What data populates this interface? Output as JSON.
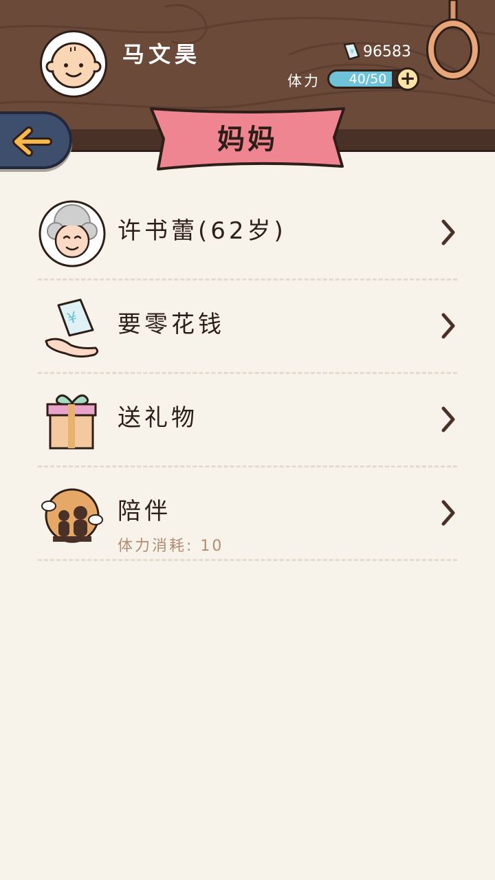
{
  "header": {
    "player_name": "马文昊",
    "money": "96583",
    "stamina_label": "体力",
    "stamina_text": "40/50",
    "stamina_fraction": 0.8,
    "stamina_plus": "+"
  },
  "banner": {
    "title": "妈妈"
  },
  "list": {
    "items": [
      {
        "title": "许书蕾(62岁)",
        "subtitle": "",
        "icon": "grandmother-avatar-icon"
      },
      {
        "title": "要零花钱",
        "subtitle": "",
        "icon": "money-hand-icon"
      },
      {
        "title": "送礼物",
        "subtitle": "",
        "icon": "gift-box-icon"
      },
      {
        "title": "陪伴",
        "subtitle": "体力消耗: 10",
        "icon": "companionship-icon"
      }
    ]
  },
  "colors": {
    "wood": "#6b4a3a",
    "background": "#f7f3ea",
    "banner": "#f08592",
    "back_button": "#3e4f6e",
    "arrow": "#f7b849",
    "stamina_fill": "#6ec3d8"
  }
}
